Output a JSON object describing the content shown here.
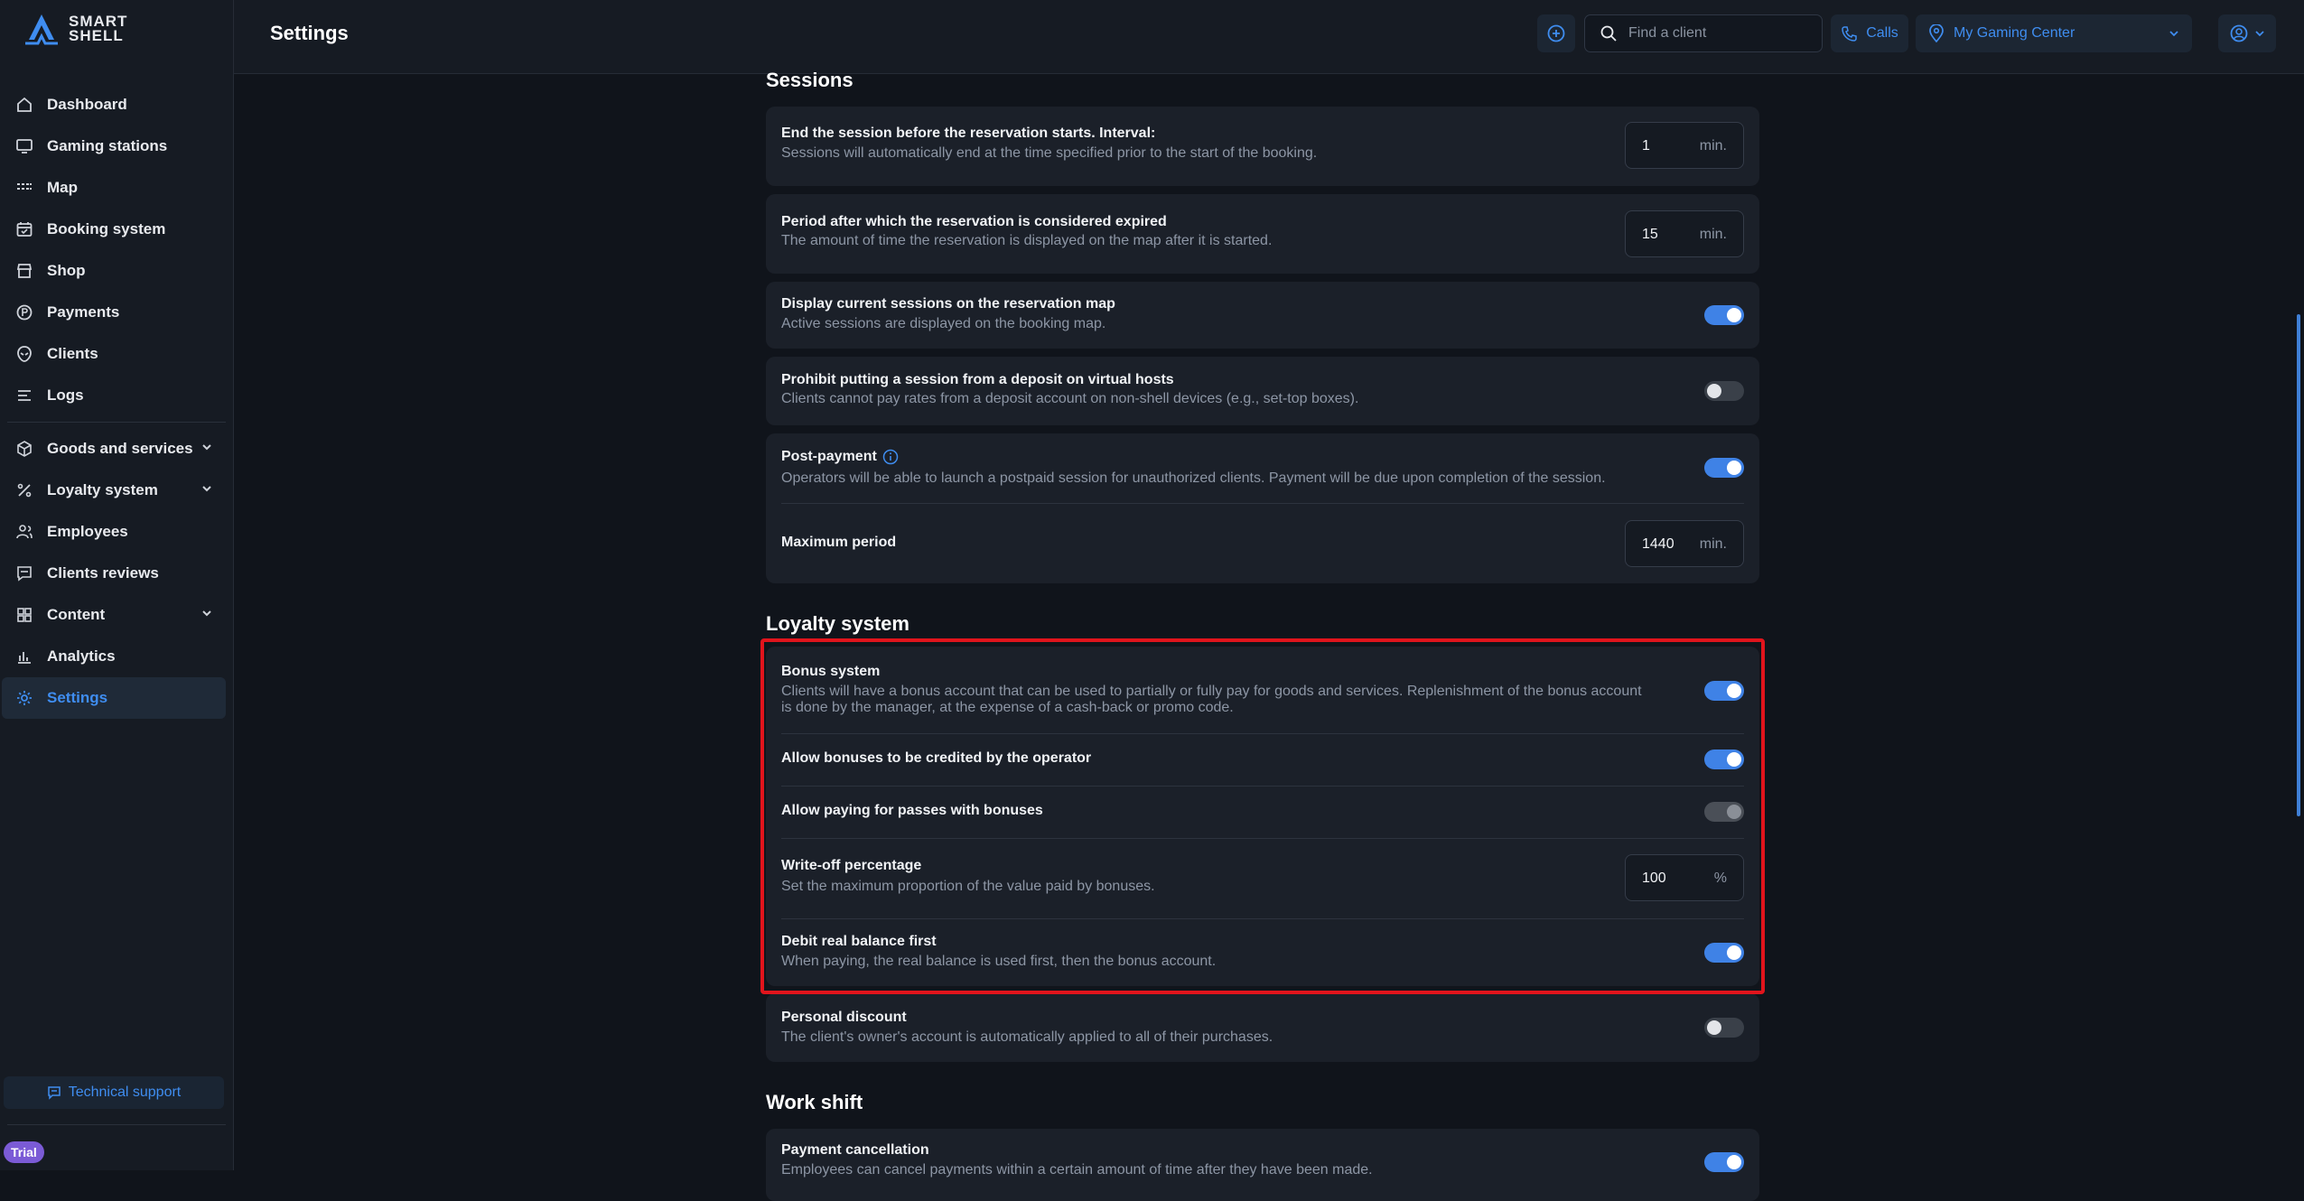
{
  "brand": {
    "line1": "SMART",
    "line2": "SHELL"
  },
  "header": {
    "title": "Settings",
    "search_placeholder": "Find a client",
    "calls_label": "Calls",
    "center_name": "My Gaming Center"
  },
  "sidebar": {
    "items": [
      {
        "label": "Dashboard",
        "icon": "home-icon"
      },
      {
        "label": "Gaming stations",
        "icon": "monitor-icon"
      },
      {
        "label": "Map",
        "icon": "map-icon"
      },
      {
        "label": "Booking system",
        "icon": "calendar-icon"
      },
      {
        "label": "Shop",
        "icon": "store-icon"
      },
      {
        "label": "Payments",
        "icon": "payment-icon"
      },
      {
        "label": "Clients",
        "icon": "alien-icon"
      },
      {
        "label": "Logs",
        "icon": "logs-icon"
      },
      {
        "label": "Goods and services",
        "icon": "box-icon"
      },
      {
        "label": "Loyalty system",
        "icon": "percent-icon"
      },
      {
        "label": "Employees",
        "icon": "employees-icon"
      },
      {
        "label": "Clients reviews",
        "icon": "reviews-icon"
      },
      {
        "label": "Content",
        "icon": "grid-icon"
      },
      {
        "label": "Analytics",
        "icon": "analytics-icon"
      },
      {
        "label": "Settings",
        "icon": "gear-icon"
      }
    ],
    "active": "Settings",
    "support_label": "Technical support",
    "trial_label": "Trial"
  },
  "sessions": {
    "title": "Sessions",
    "end_before": {
      "title": "End the session before the reservation starts. Interval:",
      "desc": "Sessions will automatically end at the time specified prior to the start of the booking.",
      "value": "1",
      "unit": "min."
    },
    "expired": {
      "title": "Period after which the reservation is considered expired",
      "desc": "The amount of time the reservation is displayed on the map after it is started.",
      "value": "15",
      "unit": "min."
    },
    "display_current": {
      "title": "Display current sessions on the reservation map",
      "desc": "Active sessions are displayed on the booking map.",
      "enabled": true
    },
    "prohibit_deposit": {
      "title": "Prohibit putting a session from a deposit on virtual hosts",
      "desc": "Clients cannot pay rates from a deposit account on non-shell devices (e.g., set-top boxes).",
      "enabled": false
    },
    "post_payment": {
      "title": "Post-payment",
      "desc": "Operators will be able to launch a postpaid session for unauthorized clients. Payment will be due upon completion of the session.",
      "enabled": true,
      "max_period_title": "Maximum period",
      "max_period_value": "1440",
      "max_period_unit": "min."
    }
  },
  "loyalty": {
    "title": "Loyalty system",
    "bonus_system": {
      "title": "Bonus system",
      "desc_line1": "Clients will have a bonus account that can be used to partially or fully pay for goods and services. Replenishment of the bonus account",
      "desc_line2": "is done by the manager, at the expense of a cash-back or promo code.",
      "enabled": true
    },
    "operator_credit": {
      "title": "Allow bonuses to be credited by the operator",
      "enabled": true
    },
    "passes_bonuses": {
      "title": "Allow paying for passes with bonuses",
      "enabled": true,
      "disabled": true
    },
    "write_off": {
      "title": "Write-off percentage",
      "desc": "Set the maximum proportion of the value paid by bonuses.",
      "value": "100",
      "unit": "%"
    },
    "debit_real": {
      "title": "Debit real balance first",
      "desc": "When paying, the real balance is used first, then the bonus account.",
      "enabled": true
    },
    "personal_discount": {
      "title": "Personal discount",
      "desc": "The client's owner's account is automatically applied to all of their purchases.",
      "enabled": false
    }
  },
  "work_shift": {
    "title": "Work shift",
    "payment_cancellation": {
      "title": "Payment cancellation",
      "desc": "Employees can cancel payments within a certain amount of time after they have been made.",
      "enabled": true
    }
  },
  "colors": {
    "accent": "#3f8df0",
    "highlight": "#e1141c",
    "trial": "#7b5bd6"
  }
}
